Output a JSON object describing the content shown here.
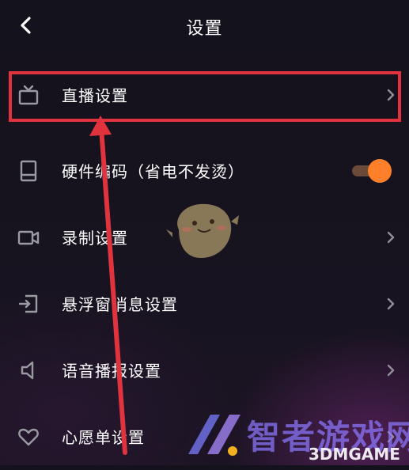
{
  "header": {
    "title": "设置"
  },
  "settings": {
    "items": [
      {
        "label": "直播设置",
        "icon": "tv-icon",
        "control": "chevron"
      },
      {
        "label": "硬件编码（省电不发烫）",
        "icon": "phone-icon",
        "control": "toggle",
        "toggle_on": true
      },
      {
        "label": "录制设置",
        "icon": "video-camera-icon",
        "control": "chevron"
      },
      {
        "label": "悬浮窗消息设置",
        "icon": "floating-window-icon",
        "control": "chevron"
      },
      {
        "label": "语音播报设置",
        "icon": "speaker-icon",
        "control": "chevron"
      },
      {
        "label": "心愿单设置",
        "icon": "heart-icon",
        "control": "chevron"
      }
    ]
  },
  "watermark": {
    "text": "智者游戏网",
    "brand": "3DMGAME"
  },
  "colors": {
    "background": "#16121e",
    "accent": "#ff7f2a",
    "annotation": "#e0333e"
  }
}
